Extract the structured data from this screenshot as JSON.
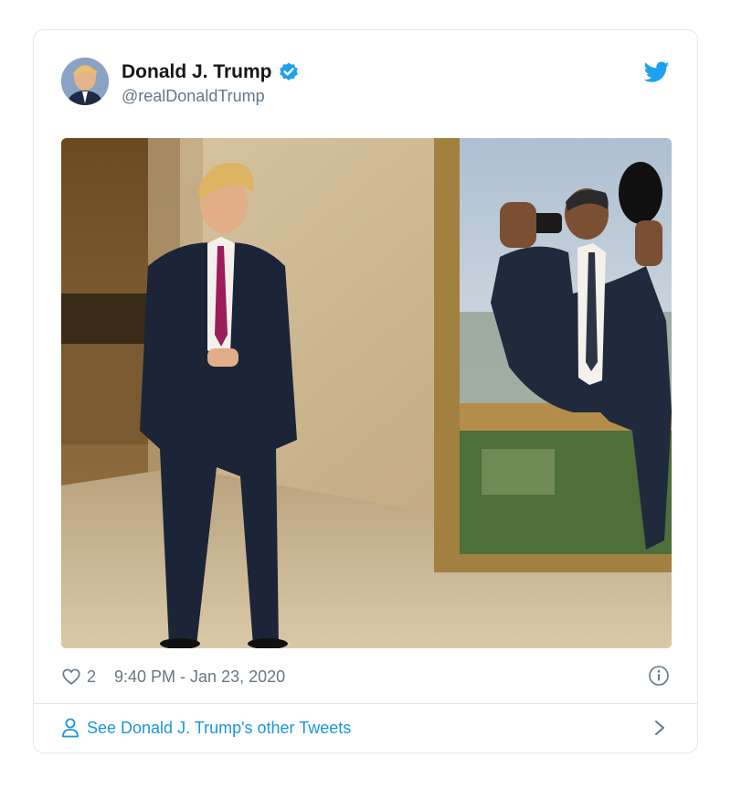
{
  "tweet": {
    "author_name": "Donald J. Trump",
    "handle": "@realDonaldTrump",
    "likes": "2",
    "timestamp": "9:40 PM - Jan 23, 2020",
    "see_more": "See Donald J. Trump's other Tweets"
  },
  "icons": {
    "verified": "verified-badge-icon",
    "logo": "twitter-bird-icon",
    "like": "heart-icon",
    "info": "info-icon",
    "profile": "person-icon",
    "more": "chevron-right-icon"
  },
  "colors": {
    "accent": "#1b95e0",
    "verified": "#1da1f2",
    "secondary_text": "#657786",
    "border": "#e1e8ed"
  }
}
